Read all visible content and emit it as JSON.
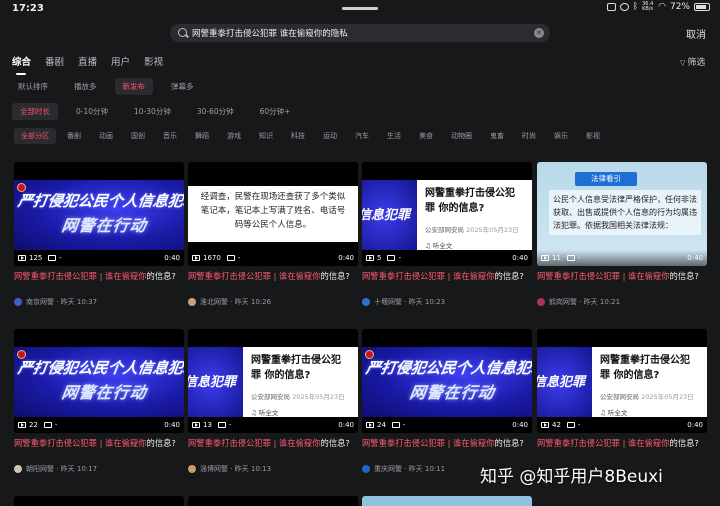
{
  "status": {
    "time": "17:23",
    "battery": "72%",
    "network": "36.4 KB/s"
  },
  "search": {
    "query": "网警重拳打击侵公犯罪 谁在偷窥你的隐私",
    "cancel_label": "取消"
  },
  "type_tabs": [
    "综合",
    "番剧",
    "直播",
    "用户",
    "影视"
  ],
  "filter_label": "筛选",
  "sort_options": [
    "默认排序",
    "播放多",
    "新发布",
    "弹幕多"
  ],
  "duration_options": [
    "全部时长",
    "0-10分钟",
    "10-30分钟",
    "30-60分钟",
    "60分钟+"
  ],
  "zones": [
    "全部分区",
    "番剧",
    "动画",
    "国创",
    "音乐",
    "舞蹈",
    "游戏",
    "知识",
    "科技",
    "运动",
    "汽车",
    "生活",
    "美食",
    "动物圈",
    "鬼畜",
    "时尚",
    "娱乐",
    "影视"
  ],
  "thumb_text": {
    "banner_line1": "严打侵犯公民个人信息犯罪",
    "banner_line2": "网警在行动",
    "strip": "信息犯罪",
    "black_card_text": "经调查，民警在现场还查获了多个类似笔记本，笔记本上写满了姓名、电话号码等公民个人信息。",
    "article_title": "网警重拳打击侵公犯罪 你的信息?",
    "article_source": "公安部网安局",
    "article_date": "2025年05月23日",
    "article_listen": "听全文",
    "legal_tag": "法律看引",
    "legal_text": "公民个人信息受法律严格保护，任何非法获取、出售或提供个人信息的行为均属违法犯罪。依据我国相关法律法规：",
    "bottom_article_date": "2025年05月23日"
  },
  "videos": [
    {
      "views": "125",
      "danmaku": "-",
      "duration": "0:40",
      "title_hl": "网警重拳打击侵公犯罪 | 谁在偷窥你",
      "title_rest": "的信息?",
      "uploader": "南京网警 · 昨天 10:37",
      "avatar_color": "#3a5fc8"
    },
    {
      "views": "1670",
      "danmaku": "-",
      "duration": "0:40",
      "title_hl": "网警重拳打击侵公犯罪 | 谁在偷窥你",
      "title_rest": "的信息?",
      "uploader": "淮北网警 · 昨天 10:26",
      "avatar_color": "#c9a47a"
    },
    {
      "views": "5",
      "danmaku": "-",
      "duration": "0:40",
      "title_hl": "网警重拳打击侵公犯罪 | 谁在偷窥你",
      "title_rest": "的信息?",
      "uploader": "十堰网警 · 昨天 10:23",
      "avatar_color": "#2f6fd6"
    },
    {
      "views": "11",
      "danmaku": "-",
      "duration": "0:40",
      "title_hl": "网警重拳打击侵公犯罪 | 谁在偷窥你",
      "title_rest": "的信息?",
      "uploader": "鹤岗网警 · 昨天 10:21",
      "avatar_color": "#b03060"
    },
    {
      "views": "22",
      "danmaku": "-",
      "duration": "0:40",
      "title_hl": "网警重拳打击侵公犯罪 | 谁在偷窥你",
      "title_rest": "的信息?",
      "uploader": "朝阳网警 · 昨天 10:17",
      "avatar_color": "#d0c6b0"
    },
    {
      "views": "13",
      "danmaku": "-",
      "duration": "0:40",
      "title_hl": "网警重拳打击侵公犯罪 | 谁在偷窥你",
      "title_rest": "的信息?",
      "uploader": "淄博网警 · 昨天 10:13",
      "avatar_color": "#c8a060"
    },
    {
      "views": "24",
      "danmaku": "-",
      "duration": "0:40",
      "title_hl": "网警重拳打击侵公犯罪 | 谁在偷窥你",
      "title_rest": "的信息?",
      "uploader": "重庆网警 · 昨天 10:11",
      "avatar_color": "#1e66c9"
    },
    {
      "views": "42",
      "danmaku": "-",
      "duration": "0:40",
      "title_hl": "网警重拳打击侵公犯罪 | 谁在偷窥你",
      "title_rest": "的信息?",
      "uploader": "",
      "avatar_color": "#444"
    }
  ],
  "watermark": "知乎 @知乎用户8Beuxi",
  "colors": {
    "accent": "#ff5b73",
    "background": "#17181a"
  }
}
